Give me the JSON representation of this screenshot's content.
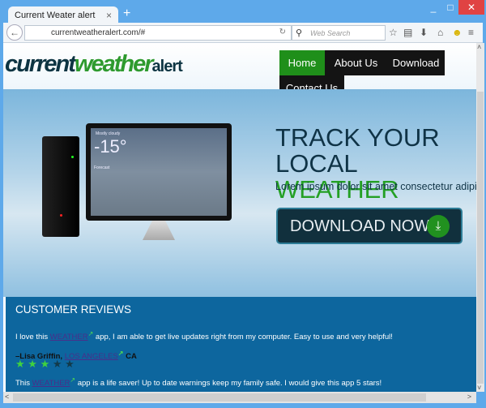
{
  "browser": {
    "tab_title": "Current Weater alert",
    "url": "currentweatheralert.com/#",
    "search_placeholder": "Web Search"
  },
  "site": {
    "logo": {
      "part1": "current",
      "part2": "weather",
      "part3": "alert"
    },
    "nav": [
      {
        "label": "Home",
        "active": true
      },
      {
        "label": "About Us"
      },
      {
        "label": "Download"
      },
      {
        "label": "Contact Us"
      }
    ],
    "hero": {
      "line1": "TRACK YOUR",
      "line2a": "LOCAL ",
      "line2b": "WEATHER",
      "lorem": "Lorem ipsum dolor sit amet consectetur adipiscing eli",
      "download_label": "DOWNLOAD NOW"
    },
    "widget": {
      "condition": "Mostly cloudy",
      "temp": "-15°",
      "label": "Forecast"
    },
    "reviews": {
      "title": "CUSTOMER REVIEWS",
      "r1_pre": "I love this ",
      "r1_link": "WEATHER",
      "r1_post": " app, I am able to get live updates right from my computer. Easy to use and very helpful!",
      "author_pre": "–Lisa Griffin, ",
      "author_link": "LOS ANGELES",
      "author_post": " CA",
      "rating": 3,
      "rating_max": 5,
      "r2_pre": "This ",
      "r2_link": "WEATHER",
      "r2_post": " app is a life saver! Up to date warnings keep my family safe. I would give this app 5 stars!"
    }
  },
  "colors": {
    "accent_green": "#24a024",
    "nav_dark": "#141414",
    "reviews_bg": "#0d669e"
  }
}
